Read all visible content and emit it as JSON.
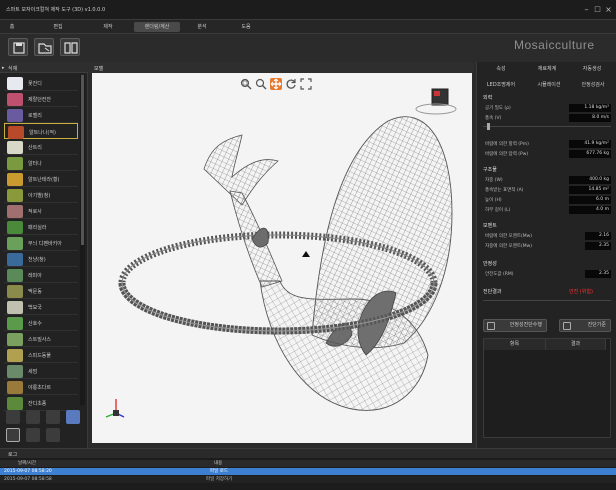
{
  "window": {
    "title": "스마트 모자이크컬쳐 제작 도구 (3D) v1.0.0.0"
  },
  "menu": [
    "홈",
    "편집",
    "제작",
    "렌더링/계산",
    "분석",
    "도움"
  ],
  "menu_active_index": 3,
  "brand": "Mosaicculture",
  "left_panel": {
    "title": "식재",
    "plants": [
      {
        "label": "꽃잔디",
        "color": "#e8e8f0"
      },
      {
        "label": "제랄던컨잔",
        "color": "#c05070"
      },
      {
        "label": "로벨리",
        "color": "#6a5aa0"
      },
      {
        "label": "알트나나(적)",
        "color": "#b84a2a"
      },
      {
        "label": "산트리",
        "color": "#d8d8c8"
      },
      {
        "label": "알터나",
        "color": "#7a9a40"
      },
      {
        "label": "알트난테라(황)",
        "color": "#c89a30"
      },
      {
        "label": "아기별(청)",
        "color": "#8a9a3a"
      },
      {
        "label": "적로사",
        "color": "#a07070"
      },
      {
        "label": "패리실라",
        "color": "#4a8a3a"
      },
      {
        "label": "무늬 디펜바키아",
        "color": "#6aa05a"
      },
      {
        "label": "천냥(청)",
        "color": "#3a6a9a"
      },
      {
        "label": "레피아",
        "color": "#5a8a5a"
      },
      {
        "label": "맥문동",
        "color": "#8a8a4a"
      },
      {
        "label": "백묘국",
        "color": "#c0c0b0"
      },
      {
        "label": "산호수",
        "color": "#5a9a4a"
      },
      {
        "label": "스트빌사스",
        "color": "#7aa060"
      },
      {
        "label": "스피드동풀",
        "color": "#b0a050"
      },
      {
        "label": "세덤",
        "color": "#6a8a6a"
      },
      {
        "label": "야룡초다르",
        "color": "#9a7a3a"
      },
      {
        "label": "잔디초종",
        "color": "#5a8a3a"
      }
    ],
    "selected_index": 3
  },
  "viewport": {
    "title": "모델",
    "tools": [
      "zoom-region-icon",
      "zoom-icon",
      "pan-icon",
      "rotate-icon",
      "fit-icon"
    ],
    "active_tool": "pan-icon"
  },
  "right_panel": {
    "tabs": [
      "속성",
      "재료체계",
      "자동생성"
    ],
    "tabs2": [
      "LED조명제어",
      "시뮬레이션",
      "안정성검사"
    ],
    "wind": {
      "title": "외력",
      "rows": [
        {
          "k": "공기 밀도 (ρ)",
          "v": "1.18 kg/m³"
        },
        {
          "k": "풍속 (V)",
          "v": "8.0 m/s"
        }
      ],
      "rows2": [
        {
          "k": "바람에 의한 항력 (Pm)",
          "v": "41.9 kg/m²"
        },
        {
          "k": "바람에 의한 압력 (Pw)",
          "v": "677.76 kg"
        }
      ]
    },
    "structure": {
      "title": "구조물",
      "rows": [
        {
          "k": "자중 (W)",
          "v": "400.0 kg"
        },
        {
          "k": "풍속받는 표면적 (A)",
          "v": "14.85 m²"
        },
        {
          "k": "높이 (H)",
          "v": "6.0 m"
        },
        {
          "k": "하부 길이 (L)",
          "v": "4.0 m"
        }
      ]
    },
    "moment": {
      "title": "모멘트",
      "rows": [
        {
          "k": "바람에 의한 모멘트(Mw)",
          "v": "2.16"
        },
        {
          "k": "자중에 의한 모멘트(Mw)",
          "v": "2.35"
        }
      ]
    },
    "stability": {
      "title": "안정성",
      "rows": [
        {
          "k": "안전도값 (RM)",
          "v": "2.35"
        }
      ]
    },
    "result_label": "전단결과",
    "result_value": "안전 (위험)",
    "buttons": [
      "안정성진단수행",
      "진단기준"
    ],
    "table_headers": [
      "항목",
      "결과"
    ]
  },
  "log": {
    "title": "로그",
    "headers": [
      "날짜/시간",
      "내용"
    ],
    "rows": [
      {
        "time": "2015-09-07 08:58:20",
        "msg": "파일 로드"
      },
      {
        "time": "2015-09-07 08:58:58",
        "msg": "파일 저장하기"
      }
    ]
  },
  "colors": {
    "accent": "#3d7fd0",
    "danger": "#ff3030",
    "highlight": "#e87a30"
  }
}
